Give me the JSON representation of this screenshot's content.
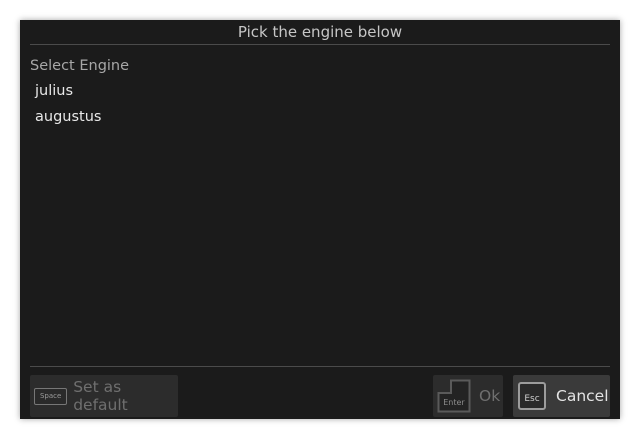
{
  "dialog": {
    "title": "Pick the engine below",
    "section_label": "Select Engine",
    "engines": [
      {
        "label": "julius"
      },
      {
        "label": "augustus"
      }
    ]
  },
  "buttons": {
    "default": {
      "key": "Space",
      "label": "Set as default",
      "key_icon": "space-key-icon"
    },
    "ok": {
      "key": "Enter",
      "label": "Ok",
      "key_icon": "enter-key-icon"
    },
    "cancel": {
      "key": "Esc",
      "label": "Cancel",
      "key_icon": "esc-key-icon"
    }
  },
  "colors": {
    "dialog_bg": "#1b1b1b",
    "button_bg": "#2c2c2c",
    "cancel_bg": "#3a3a3a",
    "separator": "#4b4b4b",
    "text_primary": "#e8e8e8",
    "text_muted": "#a7a7a7"
  }
}
